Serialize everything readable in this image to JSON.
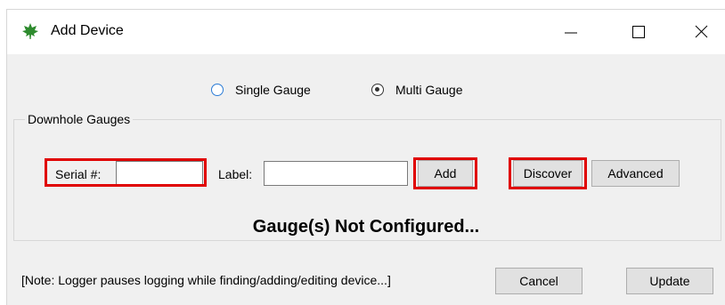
{
  "window": {
    "title": "Add Device",
    "controls": {
      "minimize": "minimize",
      "maximize": "maximize",
      "close": "close"
    }
  },
  "mode": {
    "options": [
      {
        "label": "Single Gauge",
        "selected": false
      },
      {
        "label": "Multi Gauge",
        "selected": true
      }
    ]
  },
  "group": {
    "title": "Downhole Gauges",
    "serial_label": "Serial #:",
    "serial_value": "",
    "label_label": "Label:",
    "label_value": "",
    "add_button": "Add",
    "discover_button": "Discover",
    "advanced_button": "Advanced",
    "status": "Gauge(s) Not Configured..."
  },
  "footer": {
    "note": "[Note: Logger pauses logging while finding/adding/editing device...]",
    "cancel_button": "Cancel",
    "update_button": "Update"
  },
  "colors": {
    "highlight": "#e00000",
    "radio_accent": "#2a7bd6",
    "leaf_icon": "#2e8b2e"
  },
  "icons": {
    "app": "leaf-icon"
  }
}
